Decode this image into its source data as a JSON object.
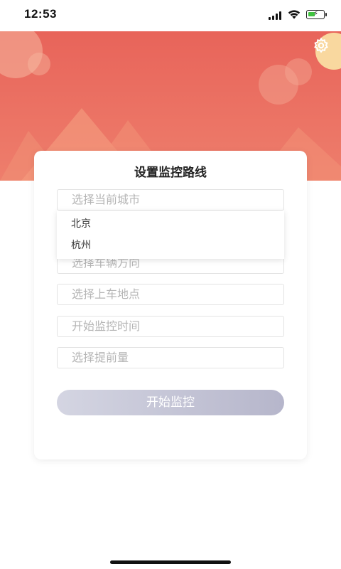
{
  "status_bar": {
    "time": "12:53"
  },
  "header": {
    "settings_icon": "gear-icon"
  },
  "form": {
    "title": "设置监控路线",
    "city_placeholder": "选择当前城市",
    "city_options": [
      "北京",
      "杭州"
    ],
    "direction_placeholder": "选择车辆方向",
    "pickup_placeholder": "选择上车地点",
    "time_placeholder": "开始监控时间",
    "advance_placeholder": "选择提前量",
    "start_button": "开始监控"
  },
  "colors": {
    "banner_top": "#e8645a",
    "banner_bottom": "#ee7e6c",
    "button_start": "#d4d5e2",
    "button_end": "#b6b6cb",
    "placeholder": "#b5b5b5"
  }
}
